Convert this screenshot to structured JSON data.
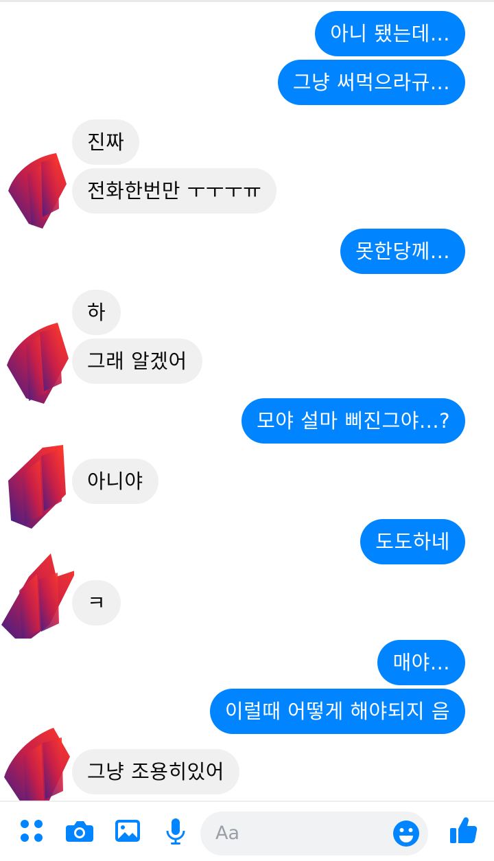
{
  "messages": [
    {
      "from": "me",
      "text": "아니 됐는데..."
    },
    {
      "from": "me",
      "text": "그냥 써먹으라규..."
    },
    {
      "from": "them",
      "text": "진짜"
    },
    {
      "from": "them",
      "text": "전화한번만 ㅜㅜㅜㅠ"
    },
    {
      "from": "me",
      "text": "못한당께..."
    },
    {
      "from": "them",
      "text": "하"
    },
    {
      "from": "them",
      "text": "그래 알겠어"
    },
    {
      "from": "me",
      "text": "모야 설마 삐진그야...?"
    },
    {
      "from": "them",
      "text": "아니야"
    },
    {
      "from": "me",
      "text": "도도하네"
    },
    {
      "from": "them",
      "text": "ㅋ"
    },
    {
      "from": "me",
      "text": "매야..."
    },
    {
      "from": "me",
      "text": "이럴때 어떻게 해야되지 음"
    },
    {
      "from": "them",
      "text": "그냥 조용히있어"
    }
  ],
  "composer": {
    "placeholder": "Aa",
    "icons": [
      "apps-icon",
      "camera-icon",
      "gallery-icon",
      "microphone-icon",
      "emoji-icon",
      "thumbs-up-icon"
    ]
  },
  "colors": {
    "accent": "#0084ff",
    "incoming_bubble": "#f0f0f0",
    "avatar_gradient_start": "#ff3a2a",
    "avatar_gradient_end": "#3a1e8a"
  }
}
